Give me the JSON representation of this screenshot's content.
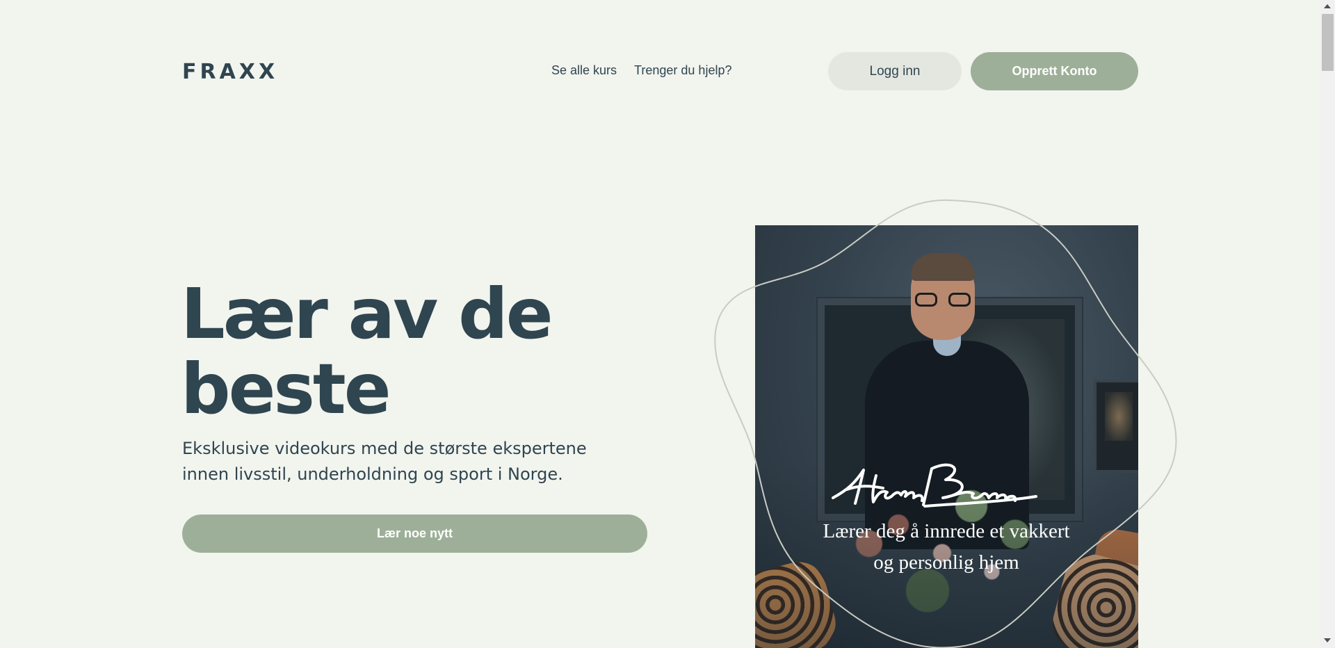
{
  "header": {
    "logo": "FRAXX",
    "nav": [
      {
        "label": "Se alle kurs"
      },
      {
        "label": "Trenger du hjelp?"
      }
    ],
    "login_label": "Logg inn",
    "signup_label": "Opprett Konto"
  },
  "hero": {
    "title_line1": "Lær av de",
    "title_line2": "beste",
    "subtitle_line1": "Eksklusive videokurs med de største ekspertene",
    "subtitle_line2": "innen livsstil, underholdning og sport i Norge.",
    "cta_label": "Lær noe nytt"
  },
  "featured": {
    "signature_text": "Halvor Bakke",
    "tagline_line1": "Lærer deg å innrede et vakkert",
    "tagline_line2": "og personlig hjem"
  },
  "colors": {
    "background": "#f2f4ee",
    "text": "#2f4550",
    "accent": "#9daf98",
    "secondary_button": "#e4e7e0"
  }
}
